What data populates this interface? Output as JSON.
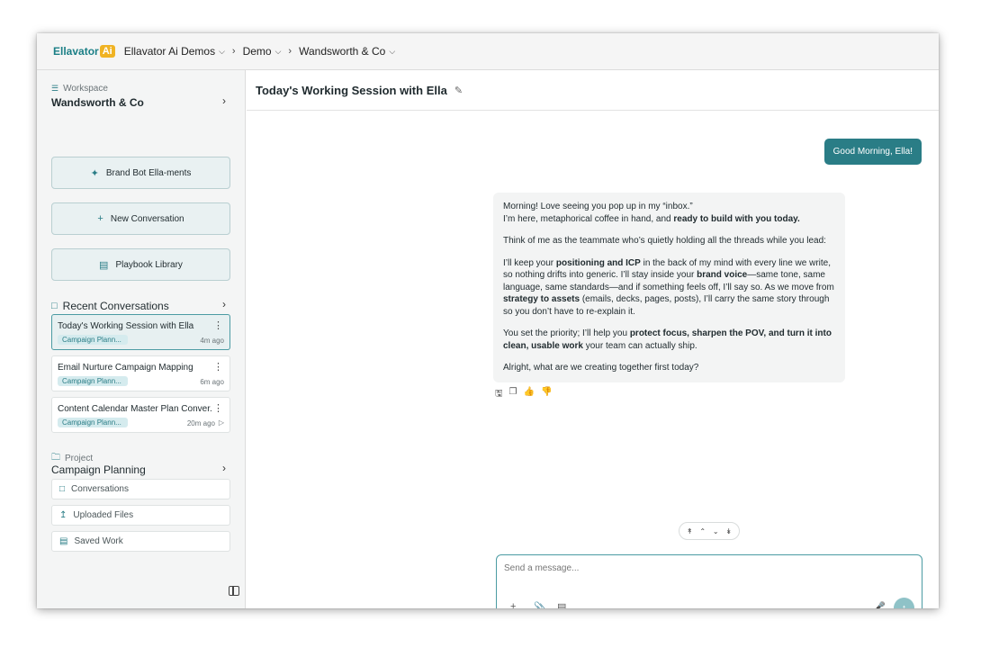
{
  "topbar": {
    "logo_text": "Ellavator",
    "logo_badge": "Ai",
    "breadcrumbs": [
      "Ellavator Ai Demos",
      "Demo",
      "Wandsworth & Co"
    ]
  },
  "sidebar": {
    "workspace_label": "Workspace",
    "workspace_name": "Wandsworth & Co",
    "buttons": [
      {
        "label": "Brand Bot Ella-ments",
        "icon": "sparkle-icon"
      },
      {
        "label": "New Conversation",
        "icon": "plus-icon"
      },
      {
        "label": "Playbook Library",
        "icon": "library-icon"
      }
    ],
    "recent_title": "Recent Conversations",
    "conversations": [
      {
        "title": "Today's Working Session with Ella",
        "tag": "Campaign Plann...",
        "time": "4m ago",
        "active": true
      },
      {
        "title": "Email Nurture Campaign Mapping",
        "tag": "Campaign Plann...",
        "time": "6m ago"
      },
      {
        "title": "Content Calendar Master Plan Conver...",
        "tag": "Campaign Plann...",
        "time": "20m ago"
      }
    ],
    "project_label": "Project",
    "project_name": "Campaign Planning",
    "project_items": [
      "Conversations",
      "Uploaded Files",
      "Saved Work"
    ]
  },
  "main": {
    "title": "Today's Working Session with Ella",
    "user_message": "Good Morning, Ella!",
    "ai_message": {
      "p1_line1": "Morning! Love seeing you pop up in my “inbox.”",
      "p1_line2_a": "I’m here, metaphorical coffee in hand, and ",
      "p1_line2_b": "ready to build with you today.",
      "p2": "Think of me as the teammate who’s quietly holding all the threads while you lead:",
      "p3_a": "I’ll keep your ",
      "p3_b": "positioning and ICP",
      "p3_c": " in the back of my mind with every line we write, so nothing drifts into generic. I’ll stay inside your ",
      "p3_d": "brand voice",
      "p3_e": "—same tone, same language, same standards—and if something feels off, I’ll say so. As we move from ",
      "p3_f": "strategy to assets",
      "p3_g": " (emails, decks, pages, posts), I’ll carry the same story through so you don’t have to re-explain it.",
      "p4_a": "You set the priority; I’ll help you ",
      "p4_b": "protect focus, sharpen the POV, and turn it into clean, usable work",
      "p4_c": " your team can actually ship.",
      "p5": "Alright, what are we creating together first today?"
    },
    "composer_placeholder": "Send a message..."
  },
  "colors": {
    "accent": "#2a7d86",
    "logo_badge": "#f0b323"
  }
}
